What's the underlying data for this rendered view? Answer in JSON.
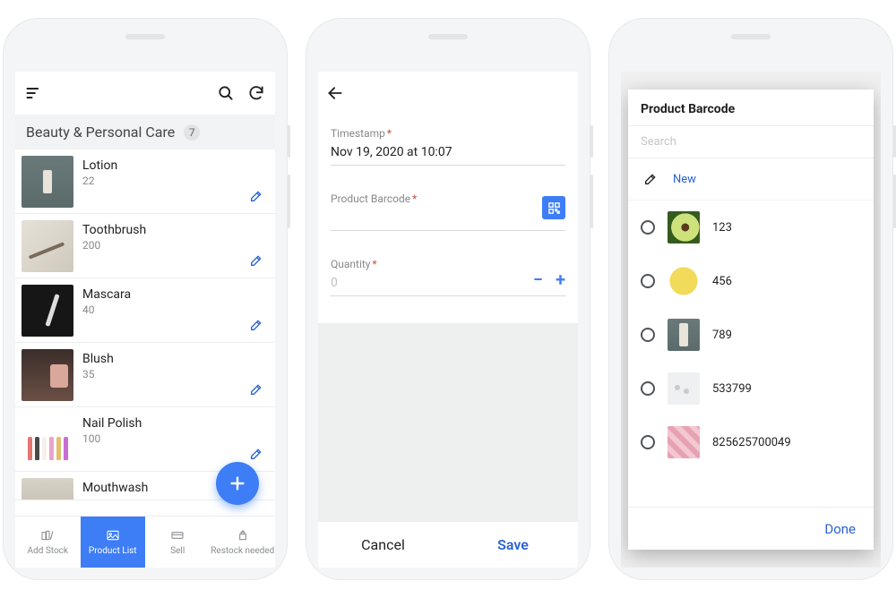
{
  "screen1": {
    "category_title": "Beauty & Personal Care",
    "category_count": "7",
    "products": [
      {
        "name": "Lotion",
        "qty": "22"
      },
      {
        "name": "Toothbrush",
        "qty": "200"
      },
      {
        "name": "Mascara",
        "qty": "40"
      },
      {
        "name": "Blush",
        "qty": "35"
      },
      {
        "name": "Nail Polish",
        "qty": "100"
      },
      {
        "name": "Mouthwash",
        "qty": ""
      }
    ],
    "tabs": {
      "add_stock": "Add Stock",
      "product_list": "Product List",
      "sell": "Sell",
      "restock": "Restock needed"
    }
  },
  "screen2": {
    "timestamp_label": "Timestamp",
    "timestamp_value": "Nov 19, 2020 at 10:07",
    "barcode_label": "Product Barcode",
    "quantity_label": "Quantity",
    "quantity_placeholder": "0",
    "cancel": "Cancel",
    "save": "Save"
  },
  "screen3": {
    "title": "Product Barcode",
    "search_placeholder": "Search",
    "new_label": "New",
    "options": [
      {
        "code": "123"
      },
      {
        "code": "456"
      },
      {
        "code": "789"
      },
      {
        "code": "533799"
      },
      {
        "code": "825625700049"
      }
    ],
    "done": "Done"
  }
}
